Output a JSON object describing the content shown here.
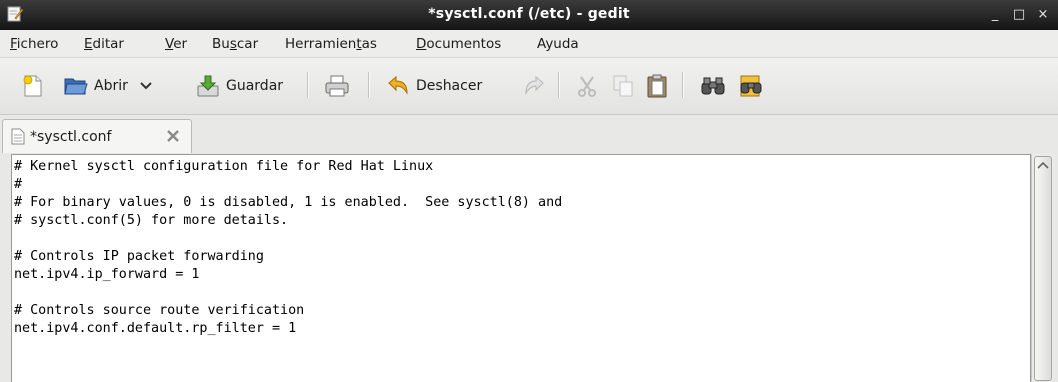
{
  "window": {
    "title": "*sysctl.conf (/etc) - gedit",
    "minimize": "_",
    "maximize": "□",
    "close": "×"
  },
  "menubar": [
    {
      "pre": "",
      "u": "F",
      "post": "ichero"
    },
    {
      "pre": "",
      "u": "E",
      "post": "ditar"
    },
    {
      "pre": "",
      "u": "V",
      "post": "er"
    },
    {
      "pre": "Bu",
      "u": "s",
      "post": "car"
    },
    {
      "pre": "Herramien",
      "u": "t",
      "post": "as"
    },
    {
      "pre": "",
      "u": "D",
      "post": "ocumentos"
    },
    {
      "pre": "Ayuda",
      "u": "",
      "post": ""
    }
  ],
  "toolbar": {
    "open_label": "Abrir",
    "save_label": "Guardar",
    "undo_label": "Deshacer"
  },
  "tab": {
    "label": "*sysctl.conf"
  },
  "editor": {
    "lines": [
      "# Kernel sysctl configuration file for Red Hat Linux",
      "#",
      "# For binary values, 0 is disabled, 1 is enabled.  See sysctl(8) and",
      "# sysctl.conf(5) for more details.",
      "",
      "# Controls IP packet forwarding",
      "net.ipv4.ip_forward = 1",
      "",
      "# Controls source route verification",
      "net.ipv4.conf.default.rp_filter = 1"
    ]
  }
}
